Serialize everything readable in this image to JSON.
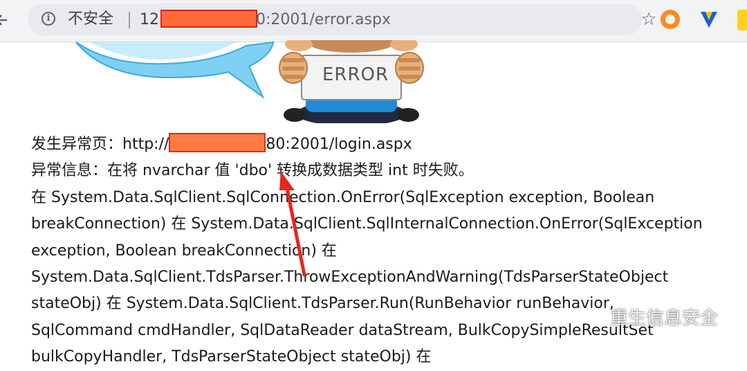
{
  "browser": {
    "security_label": "不安全",
    "url_prefix": "12",
    "url_suffix": "0:2001/error.aspx",
    "icons": [
      "back-arrow-icon",
      "info-icon",
      "star-icon",
      "extension-orange-icon",
      "extension-v-icon",
      "extension-yellow-icon"
    ]
  },
  "illustration": {
    "sign_text": "ERROR"
  },
  "error": {
    "page_label": "发生异常页：",
    "page_url_prefix": "http://",
    "page_url_suffix": "80:2001/login.aspx",
    "message": "异常信息：在将 nvarchar 值 'dbo' 转换成数据类型 int 时失败。",
    "stack_lines": [
      "在 System.Data.SqlClient.SqlConnection.OnError(SqlException exception, Boolean",
      "breakConnection) 在 System.Data.SqlClient.SqlInternalConnection.OnError(SqlException",
      "exception, Boolean breakConnection) 在",
      "System.Data.SqlClient.TdsParser.ThrowExceptionAndWarning(TdsParserStateObject",
      "stateObj) 在 System.Data.SqlClient.TdsParser.Run(RunBehavior runBehavior,",
      "SqlCommand cmdHandler, SqlDataReader dataStream, BulkCopySimpleResultSet",
      "bulkCopyHandler, TdsParserStateObject stateObj) 在"
    ]
  },
  "annotation": {
    "arrow_color": "#e8261c",
    "redaction_color": "#ff7a45"
  },
  "watermark": {
    "text": "重生信息安全"
  }
}
